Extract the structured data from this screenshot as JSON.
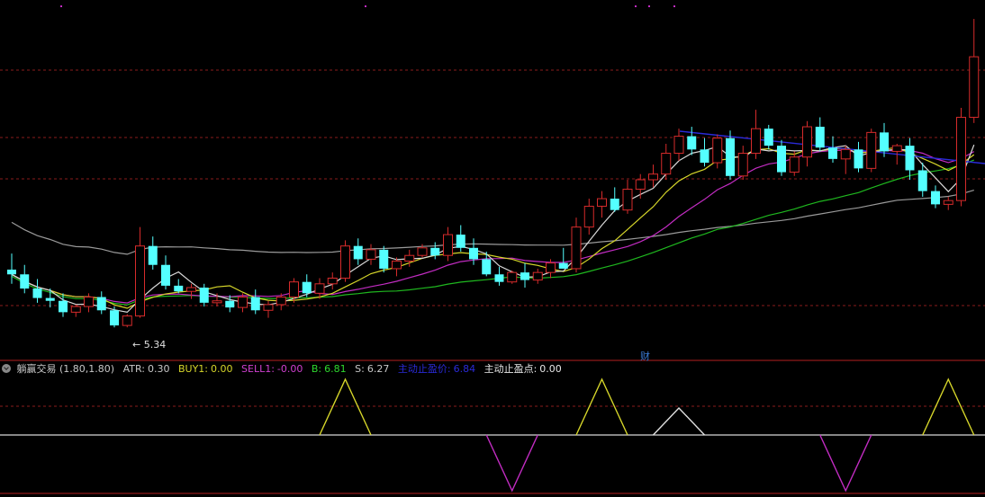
{
  "indicator": {
    "name": "躺赢交易",
    "params": "(1.80,1.80)",
    "atr_label": "ATR:",
    "atr_value": "0.30",
    "buy1_label": "BUY1:",
    "buy1_value": "0.00",
    "sell1_label": "SELL1:",
    "sell1_value": "-0.00",
    "b_label": "B:",
    "b_value": "6.81",
    "s_label": "S:",
    "s_value": "6.27",
    "stop_price_label": "主动止盈价:",
    "stop_price_value": "6.84",
    "stop_point_label": "主动止盈点:",
    "stop_point_value": "0.00"
  },
  "marker_text": "财",
  "low_label": "← 5.34",
  "colors": {
    "background": "#000000",
    "bull": "#d62b2b",
    "bear": "#54ffff",
    "grid": "#8a1c1c",
    "ma_white": "#d8d8d8",
    "ma_yellow": "#d6d62a",
    "ma_magenta": "#c22cc2",
    "ma_green": "#1fb81f",
    "ma_gray": "#9a9a9a",
    "trend": "#2a2ad8",
    "buy": "#d6d62a",
    "sell": "#c22cc2"
  },
  "chart_data": [
    {
      "type": "candlestick",
      "ylim": [
        5.0,
        8.8
      ],
      "candles": [
        [
          5.95,
          6.12,
          5.8,
          5.9
        ],
        [
          5.9,
          6.0,
          5.7,
          5.75
        ],
        [
          5.75,
          5.85,
          5.6,
          5.65
        ],
        [
          5.65,
          5.75,
          5.55,
          5.62
        ],
        [
          5.62,
          5.7,
          5.45,
          5.5
        ],
        [
          5.5,
          5.58,
          5.45,
          5.56
        ],
        [
          5.56,
          5.7,
          5.5,
          5.66
        ],
        [
          5.66,
          5.72,
          5.48,
          5.52
        ],
        [
          5.52,
          5.56,
          5.34,
          5.36
        ],
        [
          5.36,
          5.48,
          5.34,
          5.46
        ],
        [
          5.46,
          6.4,
          5.44,
          6.2
        ],
        [
          6.2,
          6.3,
          5.95,
          6.0
        ],
        [
          6.0,
          6.1,
          5.74,
          5.78
        ],
        [
          5.78,
          5.85,
          5.7,
          5.72
        ],
        [
          5.72,
          5.8,
          5.64,
          5.76
        ],
        [
          5.76,
          5.8,
          5.56,
          5.6
        ],
        [
          5.6,
          5.7,
          5.56,
          5.62
        ],
        [
          5.62,
          5.68,
          5.5,
          5.55
        ],
        [
          5.55,
          5.7,
          5.5,
          5.66
        ],
        [
          5.66,
          5.74,
          5.48,
          5.52
        ],
        [
          5.52,
          5.62,
          5.44,
          5.58
        ],
        [
          5.58,
          5.7,
          5.52,
          5.66
        ],
        [
          5.66,
          5.86,
          5.6,
          5.82
        ],
        [
          5.82,
          5.9,
          5.66,
          5.7
        ],
        [
          5.7,
          5.86,
          5.64,
          5.8
        ],
        [
          5.8,
          5.92,
          5.74,
          5.86
        ],
        [
          5.86,
          6.26,
          5.82,
          6.2
        ],
        [
          6.2,
          6.28,
          6.0,
          6.06
        ],
        [
          6.06,
          6.22,
          6.0,
          6.16
        ],
        [
          6.16,
          6.2,
          5.92,
          5.96
        ],
        [
          5.96,
          6.08,
          5.88,
          6.04
        ],
        [
          6.04,
          6.16,
          5.98,
          6.1
        ],
        [
          6.1,
          6.22,
          6.08,
          6.18
        ],
        [
          6.18,
          6.24,
          6.06,
          6.1
        ],
        [
          6.1,
          6.4,
          6.04,
          6.32
        ],
        [
          6.32,
          6.42,
          6.14,
          6.18
        ],
        [
          6.18,
          6.28,
          6.0,
          6.06
        ],
        [
          6.06,
          6.14,
          5.88,
          5.9
        ],
        [
          5.9,
          5.98,
          5.78,
          5.82
        ],
        [
          5.82,
          5.94,
          5.8,
          5.92
        ],
        [
          5.92,
          6.02,
          5.76,
          5.84
        ],
        [
          5.84,
          5.96,
          5.8,
          5.92
        ],
        [
          5.92,
          6.06,
          5.86,
          6.02
        ],
        [
          6.02,
          6.18,
          5.96,
          5.96
        ],
        [
          5.96,
          6.5,
          5.92,
          6.4
        ],
        [
          6.4,
          6.7,
          6.32,
          6.62
        ],
        [
          6.62,
          6.78,
          6.5,
          6.7
        ],
        [
          6.7,
          6.82,
          6.56,
          6.58
        ],
        [
          6.58,
          6.9,
          6.54,
          6.8
        ],
        [
          6.8,
          6.96,
          6.7,
          6.9
        ],
        [
          6.9,
          7.06,
          6.82,
          6.96
        ],
        [
          6.96,
          7.28,
          6.9,
          7.18
        ],
        [
          7.18,
          7.44,
          7.1,
          7.36
        ],
        [
          7.36,
          7.46,
          7.16,
          7.22
        ],
        [
          7.22,
          7.34,
          7.04,
          7.08
        ],
        [
          7.08,
          7.38,
          7.02,
          7.34
        ],
        [
          7.34,
          7.42,
          6.9,
          6.94
        ],
        [
          6.94,
          7.26,
          6.9,
          7.18
        ],
        [
          7.18,
          7.64,
          7.12,
          7.44
        ],
        [
          7.44,
          7.48,
          7.22,
          7.26
        ],
        [
          7.26,
          7.32,
          6.94,
          6.98
        ],
        [
          6.98,
          7.2,
          6.94,
          7.14
        ],
        [
          7.14,
          7.52,
          7.04,
          7.46
        ],
        [
          7.46,
          7.56,
          7.2,
          7.24
        ],
        [
          7.24,
          7.36,
          7.08,
          7.12
        ],
        [
          7.12,
          7.26,
          6.96,
          7.22
        ],
        [
          7.22,
          7.3,
          6.98,
          7.02
        ],
        [
          7.02,
          7.44,
          6.98,
          7.4
        ],
        [
          7.4,
          7.5,
          7.14,
          7.2
        ],
        [
          7.2,
          7.28,
          7.06,
          7.26
        ],
        [
          7.26,
          7.34,
          6.9,
          7.0
        ],
        [
          7.0,
          7.08,
          6.72,
          6.78
        ],
        [
          6.78,
          6.84,
          6.6,
          6.64
        ],
        [
          6.64,
          6.72,
          6.58,
          6.68
        ],
        [
          6.68,
          7.66,
          6.62,
          7.56
        ],
        [
          7.56,
          8.6,
          7.5,
          8.2
        ]
      ]
    },
    {
      "type": "line",
      "ylim": [
        -1,
        1
      ],
      "series": [
        {
          "role": "buy",
          "color": "#d6d62a",
          "peaks": [
            26,
            46,
            73
          ]
        },
        {
          "role": "sell",
          "color": "#c22cc2",
          "troughs": [
            39,
            65
          ]
        },
        {
          "role": "small",
          "color": "#e0e0e0",
          "peaks": [
            52
          ]
        }
      ]
    }
  ]
}
